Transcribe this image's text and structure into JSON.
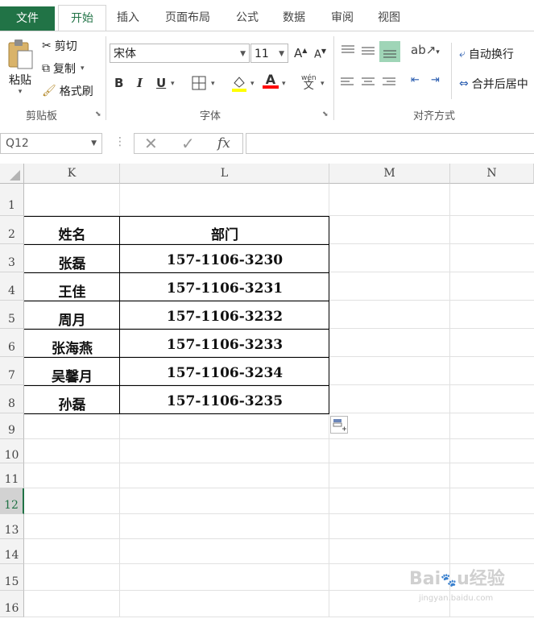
{
  "ribbon_tabs": [
    "文件",
    "开始",
    "插入",
    "页面布局",
    "公式",
    "数据",
    "审阅",
    "视图"
  ],
  "clipboard": {
    "paste": "粘贴",
    "cut": "剪切",
    "copy": "复制",
    "format_painter": "格式刷",
    "group": "剪贴板"
  },
  "font": {
    "name": "宋体",
    "size": "11",
    "bold": "B",
    "italic": "I",
    "underline": "U",
    "group": "字体"
  },
  "alignment": {
    "wrap_text": "自动换行",
    "merge_center": "合并后居中",
    "group": "对齐方式"
  },
  "formula_bar": {
    "name_box": "Q12",
    "fx": "fx",
    "value": ""
  },
  "columns": [
    "K",
    "L",
    "M",
    "N"
  ],
  "rows": [
    "1",
    "2",
    "3",
    "4",
    "5",
    "6",
    "7",
    "8",
    "9",
    "10",
    "11",
    "12",
    "13",
    "14",
    "15",
    "16"
  ],
  "active_row": "12",
  "table": {
    "headers": [
      "姓名",
      "部门"
    ],
    "rows": [
      [
        "张磊",
        "157-1106-3230"
      ],
      [
        "王佳",
        "157-1106-3231"
      ],
      [
        "周月",
        "157-1106-3232"
      ],
      [
        "张海燕",
        "157-1106-3233"
      ],
      [
        "吴馨月",
        "157-1106-3234"
      ],
      [
        "孙磊",
        "157-1106-3235"
      ]
    ]
  },
  "watermark": "Baidu经验 jingyan.baidu.com",
  "colors": {
    "accent": "#217346",
    "fill_highlight": "#ffff00",
    "font_color": "#ff0000"
  }
}
